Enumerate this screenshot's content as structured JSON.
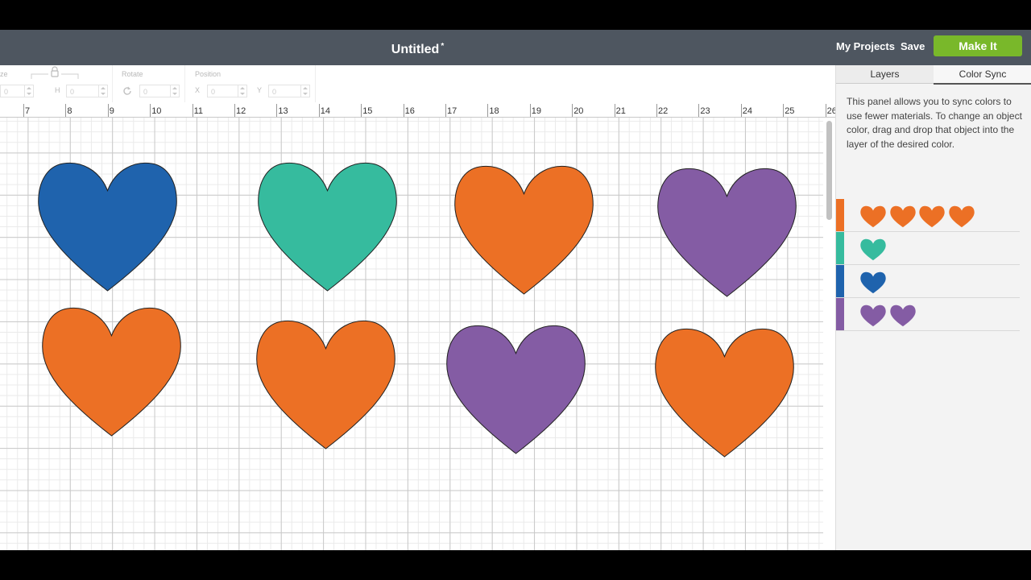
{
  "header": {
    "title": "Untitled",
    "unsaved_mark": "*",
    "my_projects": "My Projects",
    "save": "Save",
    "make_it": "Make It"
  },
  "toolbar": {
    "size_label": "ze",
    "h_label": "H",
    "w_value": "0",
    "h_value": "0",
    "rotate_label": "Rotate",
    "rotate_value": "0",
    "position_label": "Position",
    "x_label": "X",
    "y_label": "Y",
    "x_value": "0",
    "y_value": "0",
    "lock_icon": "lock-icon",
    "rotate_icon": "rotate-icon"
  },
  "ruler": {
    "ticks": [
      "7",
      "8",
      "9",
      "10",
      "11",
      "12",
      "13",
      "14",
      "15",
      "16",
      "17",
      "18",
      "19",
      "20",
      "21",
      "22",
      "23",
      "24",
      "25",
      "26"
    ]
  },
  "canvas": {
    "hearts": [
      {
        "name": "heart-blue",
        "color": "#1f63ad"
      },
      {
        "name": "heart-teal",
        "color": "#36bb9e"
      },
      {
        "name": "heart-orange-1",
        "color": "#ec7025"
      },
      {
        "name": "heart-purple-1",
        "color": "#845ca4"
      },
      {
        "name": "heart-orange-2",
        "color": "#ec7025"
      },
      {
        "name": "heart-orange-3",
        "color": "#ec7025"
      },
      {
        "name": "heart-purple-2",
        "color": "#845ca4"
      },
      {
        "name": "heart-orange-4",
        "color": "#ec7025"
      }
    ]
  },
  "panel": {
    "tab_layers": "Layers",
    "tab_color_sync": "Color Sync",
    "description": "This panel allows you to sync colors to use fewer materials. To change an object color, drag and drop that object into the layer of the desired color.",
    "sync_groups": [
      {
        "color": "#ec7025",
        "count": 4
      },
      {
        "color": "#36bb9e",
        "count": 1
      },
      {
        "color": "#1f63ad",
        "count": 1
      },
      {
        "color": "#845ca4",
        "count": 2
      }
    ]
  }
}
